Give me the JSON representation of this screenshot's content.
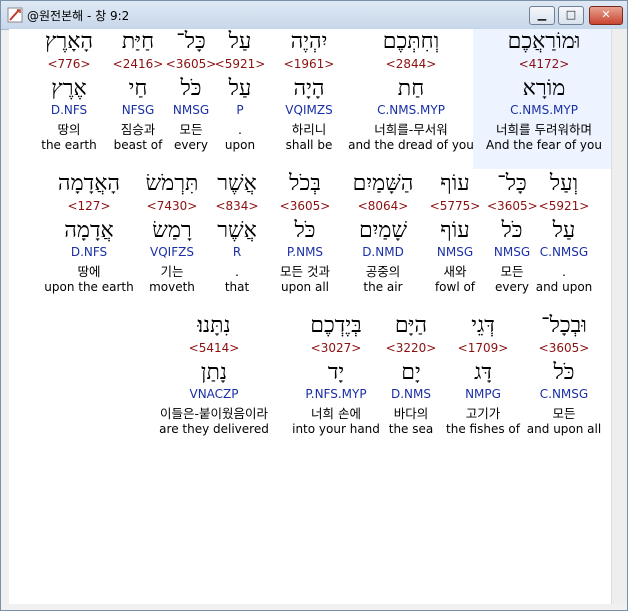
{
  "window": {
    "title": "@원전본해 - 창 9:2",
    "min_label": "▁",
    "max_label": "□",
    "close_label": "✕"
  },
  "rows": [
    [
      {
        "heb": "וּמוֹרַאֲכֶם",
        "num": "<4172>",
        "root": "מוֹרָא",
        "code": "C.NMS.MYP",
        "kor": "너희를 두려워하며",
        "eng": "And the fear of you"
      },
      {
        "heb": "וְחִתְּכֶם",
        "num": "<2844>",
        "root": "חַת",
        "code": "C.NMS.MYP",
        "kor": "너희를-무서워",
        "eng": "and the dread of you"
      },
      {
        "heb": "יִהְיֶה",
        "num": "<1961>",
        "root": "הָיָה",
        "code": "VQIMZS",
        "kor": "하리니",
        "eng": "shall be"
      },
      {
        "heb": "עַל",
        "num": "<5921>",
        "root": "עַל",
        "code": "P",
        "kor": ".",
        "eng": "upon"
      },
      {
        "heb": "כָּל־",
        "num": "<3605>",
        "root": "כֹּל",
        "code": "NMSG",
        "kor": "모든",
        "eng": "every"
      },
      {
        "heb": "חַיַּת",
        "num": "<2416>",
        "root": "חַי",
        "code": "NFSG",
        "kor": "짐승과",
        "eng": "beast of"
      },
      {
        "heb": "הָאָרֶץ",
        "num": "<776>",
        "root": "אֶרֶץ",
        "code": "D.NFS",
        "kor": "땅의",
        "eng": "the earth"
      }
    ],
    [
      {
        "heb": "וְעַל",
        "num": "<5921>",
        "root": "עַל",
        "code": "C.NMSG",
        "kor": ".",
        "eng": "and upon"
      },
      {
        "heb": "כָּל־",
        "num": "<3605>",
        "root": "כֹּל",
        "code": "NMSG",
        "kor": "모든",
        "eng": "every"
      },
      {
        "heb": "עוֹף",
        "num": "<5775>",
        "root": "עוֹף",
        "code": "NMSG",
        "kor": "새와",
        "eng": "fowl of"
      },
      {
        "heb": "הַשָּׁמַיִם",
        "num": "<8064>",
        "root": "שָׁמַיִם",
        "code": "D.NMD",
        "kor": "공중의",
        "eng": "the air"
      },
      {
        "heb": "בְּכֹל",
        "num": "<3605>",
        "root": "כֹּל",
        "code": "P.NMS",
        "kor": "모든 것과",
        "eng": "upon all"
      },
      {
        "heb": "אֲשֶׁר",
        "num": "<834>",
        "root": "אֲשֶׁר",
        "code": "R",
        "kor": ".",
        "eng": "that"
      },
      {
        "heb": "תִּרְמֹשׂ",
        "num": "<7430>",
        "root": "רָמַשׂ",
        "code": "VQIFZS",
        "kor": "기는",
        "eng": "moveth"
      },
      {
        "heb": "הָאֲדָמָה",
        "num": "<127>",
        "root": "אֲדָמָה",
        "code": "D.NFS",
        "kor": "땅에",
        "eng": "upon the earth"
      }
    ],
    [
      {
        "heb": "וּבְכָל־",
        "num": "<3605>",
        "root": "כֹּל",
        "code": "C.NMSG",
        "kor": "모든",
        "eng": "and upon all"
      },
      {
        "heb": "דְּגֵי",
        "num": "<1709>",
        "root": "דָּג",
        "code": "NMPG",
        "kor": "고기가",
        "eng": "the fishes of"
      },
      {
        "heb": "הַיָּם",
        "num": "<3220>",
        "root": "יָם",
        "code": "D.NMS",
        "kor": "바다의",
        "eng": "the sea"
      },
      {
        "heb": "בְּיֶדְכֶם",
        "num": "<3027>",
        "root": "יָד",
        "code": "P.NFS.MYP",
        "kor": "너희 손에",
        "eng": "into your hand"
      },
      {
        "heb": "נִתָּנוּ׃",
        "num": "<5414>",
        "root": "נָתַן",
        "code": "VNACZP",
        "kor": "이들은-붙이웠음이라",
        "eng": "are they delivered"
      }
    ]
  ]
}
